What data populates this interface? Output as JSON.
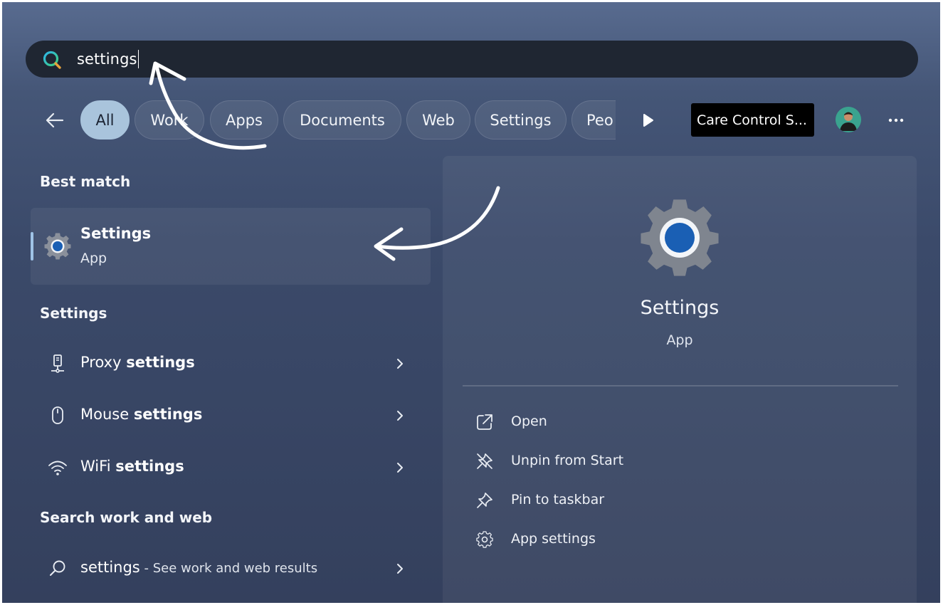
{
  "search": {
    "query": "settings"
  },
  "filters": {
    "chips": [
      {
        "label": "All",
        "active": true
      },
      {
        "label": "Work"
      },
      {
        "label": "Apps"
      },
      {
        "label": "Documents"
      },
      {
        "label": "Web"
      },
      {
        "label": "Settings"
      },
      {
        "label": "Peo"
      }
    ],
    "organization": "Care Control S..."
  },
  "best_match": {
    "heading": "Best match",
    "title": "Settings",
    "subtitle": "App",
    "icon": "settings-gear-icon"
  },
  "settings_section": {
    "heading": "Settings",
    "items": [
      {
        "prefix": "Proxy ",
        "bold": "settings",
        "icon": "proxy-icon"
      },
      {
        "prefix": "Mouse ",
        "bold": "settings",
        "icon": "mouse-icon"
      },
      {
        "prefix": "WiFi ",
        "bold": "settings",
        "icon": "wifi-icon"
      }
    ]
  },
  "web_section": {
    "heading": "Search work and web",
    "query": "settings",
    "hint": " - See work and web results"
  },
  "detail": {
    "title": "Settings",
    "subtitle": "App",
    "actions": [
      {
        "label": "Open",
        "icon": "open-external-icon"
      },
      {
        "label": "Unpin from Start",
        "icon": "unpin-icon"
      },
      {
        "label": "Pin to taskbar",
        "icon": "pin-icon"
      },
      {
        "label": "App settings",
        "icon": "gear-icon"
      }
    ]
  },
  "colors": {
    "accent": "#a9c4dc",
    "selection": "#9fc3e6",
    "gear_blue": "#1a5fb4"
  }
}
